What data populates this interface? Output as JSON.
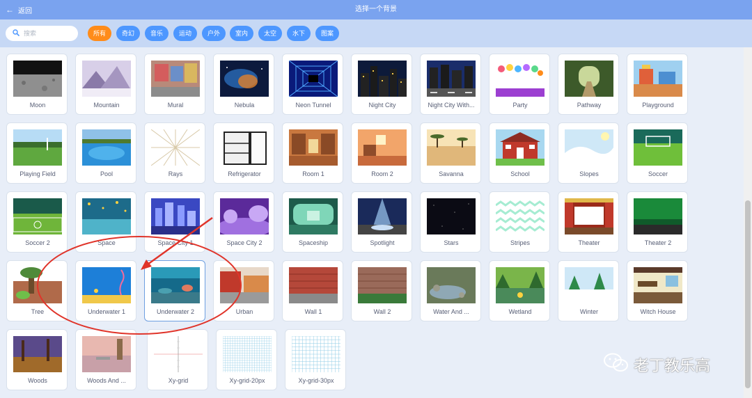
{
  "header": {
    "back_label": "返回",
    "title": "选择一个背景"
  },
  "search": {
    "placeholder": "搜索"
  },
  "filters": [
    {
      "label": "所有",
      "active": true
    },
    {
      "label": "奇幻"
    },
    {
      "label": "音乐"
    },
    {
      "label": "运动"
    },
    {
      "label": "户外"
    },
    {
      "label": "室内"
    },
    {
      "label": "太空"
    },
    {
      "label": "水下"
    },
    {
      "label": "图案"
    }
  ],
  "backdrops": [
    {
      "label": "Moon",
      "icon": "moon-thumbnail"
    },
    {
      "label": "Mountain",
      "icon": "mountain-thumbnail"
    },
    {
      "label": "Mural",
      "icon": "mural-thumbnail"
    },
    {
      "label": "Nebula",
      "icon": "nebula-thumbnail"
    },
    {
      "label": "Neon Tunnel",
      "icon": "neon-tunnel-thumbnail"
    },
    {
      "label": "Night City",
      "icon": "night-city-thumbnail"
    },
    {
      "label": "Night City With...",
      "icon": "night-city-street-thumbnail"
    },
    {
      "label": "Party",
      "icon": "party-thumbnail"
    },
    {
      "label": "Pathway",
      "icon": "pathway-thumbnail"
    },
    {
      "label": "Playground",
      "icon": "playground-thumbnail"
    },
    {
      "label": "Playing Field",
      "icon": "playing-field-thumbnail"
    },
    {
      "label": "Pool",
      "icon": "pool-thumbnail"
    },
    {
      "label": "Rays",
      "icon": "rays-thumbnail"
    },
    {
      "label": "Refrigerator",
      "icon": "refrigerator-thumbnail"
    },
    {
      "label": "Room 1",
      "icon": "room1-thumbnail"
    },
    {
      "label": "Room 2",
      "icon": "room2-thumbnail"
    },
    {
      "label": "Savanna",
      "icon": "savanna-thumbnail"
    },
    {
      "label": "School",
      "icon": "school-thumbnail"
    },
    {
      "label": "Slopes",
      "icon": "slopes-thumbnail"
    },
    {
      "label": "Soccer",
      "icon": "soccer-thumbnail"
    },
    {
      "label": "Soccer 2",
      "icon": "soccer2-thumbnail"
    },
    {
      "label": "Space",
      "icon": "space-thumbnail"
    },
    {
      "label": "Space City 1",
      "icon": "space-city1-thumbnail"
    },
    {
      "label": "Space City 2",
      "icon": "space-city2-thumbnail"
    },
    {
      "label": "Spaceship",
      "icon": "spaceship-thumbnail"
    },
    {
      "label": "Spotlight",
      "icon": "spotlight-thumbnail"
    },
    {
      "label": "Stars",
      "icon": "stars-thumbnail"
    },
    {
      "label": "Stripes",
      "icon": "stripes-thumbnail"
    },
    {
      "label": "Theater",
      "icon": "theater-thumbnail"
    },
    {
      "label": "Theater 2",
      "icon": "theater2-thumbnail"
    },
    {
      "label": "Tree",
      "icon": "tree-thumbnail"
    },
    {
      "label": "Underwater 1",
      "icon": "underwater1-thumbnail"
    },
    {
      "label": "Underwater 2",
      "icon": "underwater2-thumbnail",
      "selected": true
    },
    {
      "label": "Urban",
      "icon": "urban-thumbnail"
    },
    {
      "label": "Wall 1",
      "icon": "wall1-thumbnail"
    },
    {
      "label": "Wall 2",
      "icon": "wall2-thumbnail"
    },
    {
      "label": "Water And ...",
      "icon": "water-and-rocks-thumbnail"
    },
    {
      "label": "Wetland",
      "icon": "wetland-thumbnail"
    },
    {
      "label": "Winter",
      "icon": "winter-thumbnail"
    },
    {
      "label": "Witch House",
      "icon": "witch-house-thumbnail"
    },
    {
      "label": "Woods",
      "icon": "woods-thumbnail"
    },
    {
      "label": "Woods And ...",
      "icon": "woods-and-bench-thumbnail"
    },
    {
      "label": "Xy-grid",
      "icon": "xy-grid-thumbnail"
    },
    {
      "label": "Xy-grid-20px",
      "icon": "xy-grid-20px-thumbnail"
    },
    {
      "label": "Xy-grid-30px",
      "icon": "xy-grid-30px-thumbnail"
    }
  ],
  "watermark": {
    "text": "老丁教乐高",
    "icon": "wechat-icon"
  },
  "colors": {
    "header": "#7aa3ef",
    "filter_bar": "#c6d8f5",
    "chip": "#4d97ff",
    "chip_active": "#ff8c1a",
    "annotation": "#e0342a"
  }
}
